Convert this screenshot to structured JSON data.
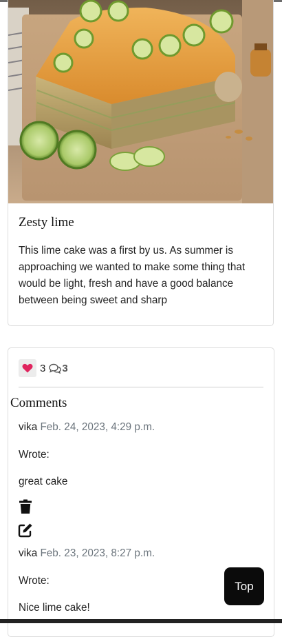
{
  "post": {
    "title": "Zesty lime",
    "body": "This lime cake was a first by us. As summer is approaching we wanted to make some thing that would be light, fresh and have a good balance between being sweet and sharp",
    "image_icon": "lime-crepe-cake-photo"
  },
  "stats": {
    "likes": "3",
    "comments": "3",
    "like_icon": "heart-icon",
    "comment_icon": "comments-icon",
    "like_color": "#e0245e"
  },
  "comments_section": {
    "heading": "Comments",
    "items": [
      {
        "author": "vika",
        "date": "Feb. 24, 2023, 4:29 p.m.",
        "wrote": "Wrote:",
        "text": "great cake"
      },
      {
        "author": "vika",
        "date": "Feb. 23, 2023, 8:27 p.m.",
        "wrote": "Wrote:",
        "text": "Nice lime cake!"
      }
    ],
    "delete_icon": "trash-icon",
    "edit_icon": "edit-icon"
  },
  "top_button": {
    "label": "Top"
  }
}
